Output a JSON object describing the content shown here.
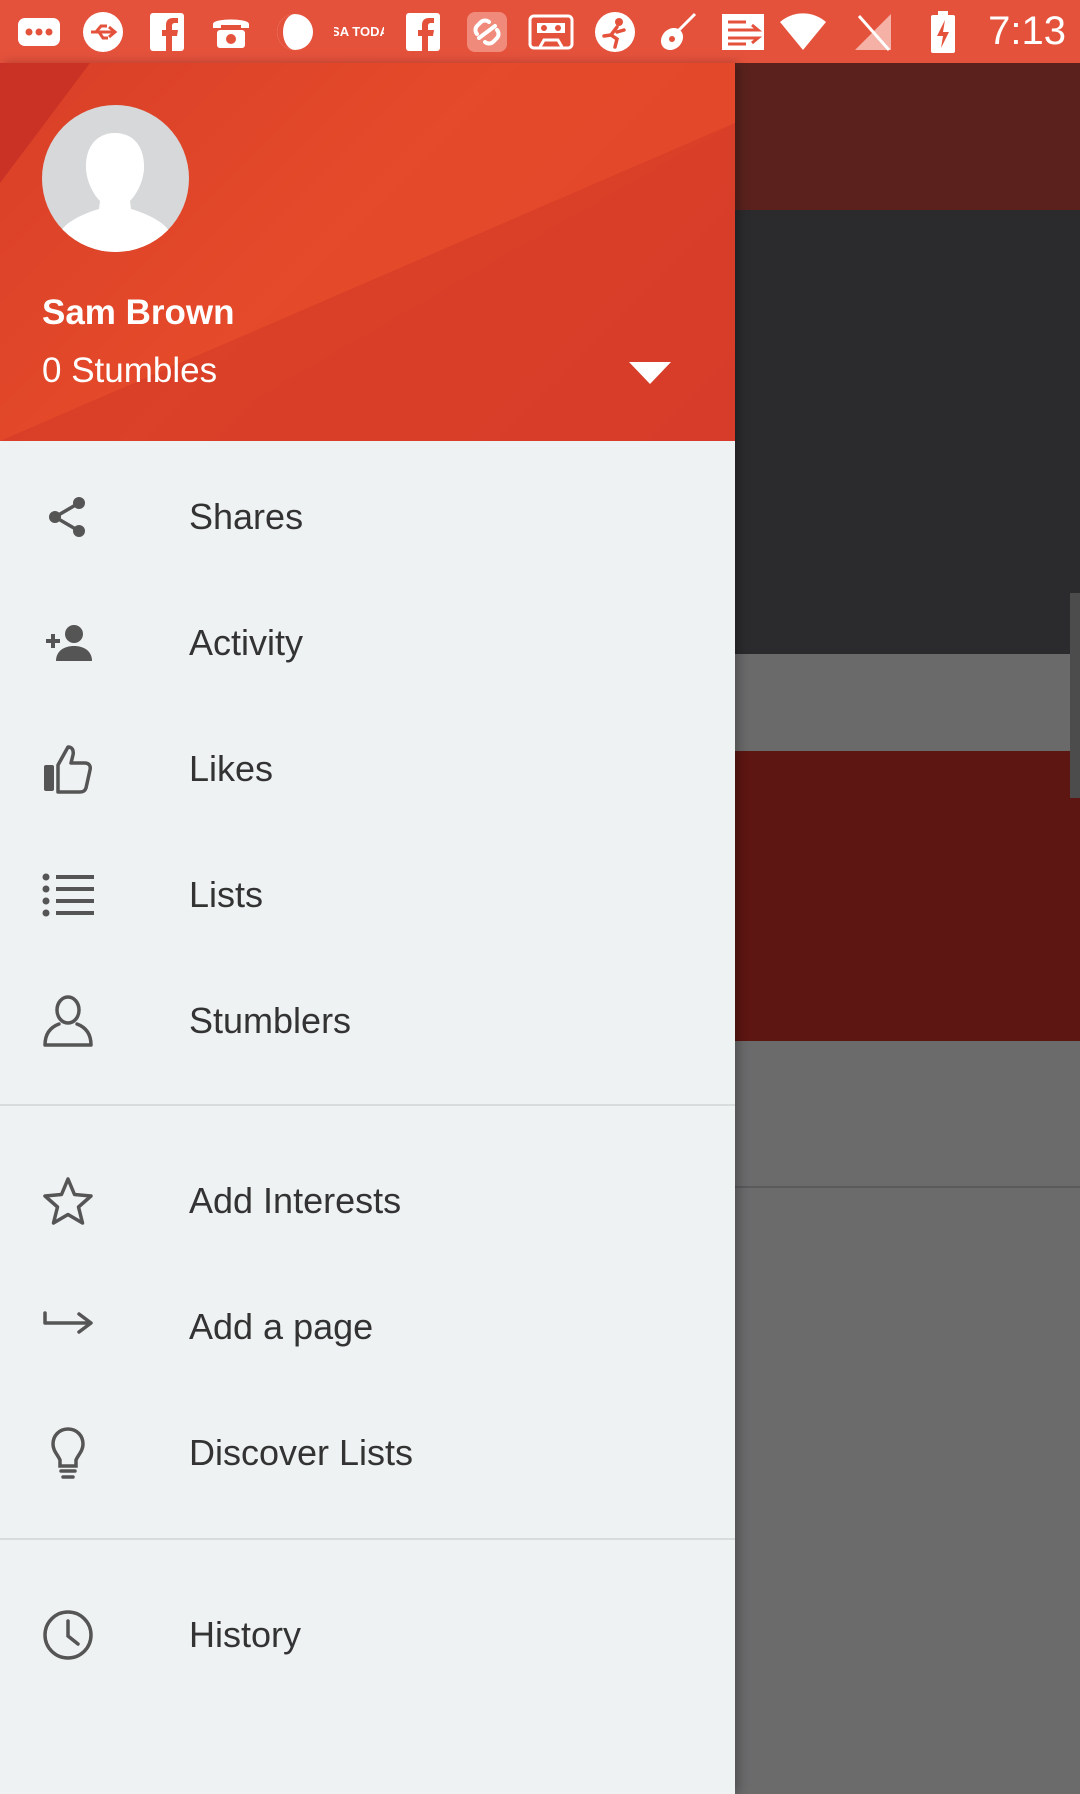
{
  "status_bar": {
    "time": "7:13",
    "notification_icons": [
      "more-icon",
      "usb-icon",
      "facebook-icon",
      "phone-icon",
      "moon-icon",
      "usa-today-icon",
      "facebook-icon",
      "link-icon",
      "cassette-icon",
      "soccer-icon",
      "violin-icon",
      "cast-icon"
    ],
    "usa_today_text": "USA TODAY",
    "system_icons": [
      "wifi-icon",
      "signal-off-icon",
      "battery-charging-icon"
    ]
  },
  "drawer": {
    "header": {
      "name": "Sam Brown",
      "stumbles": "0 Stumbles"
    },
    "sections": [
      {
        "items": [
          {
            "label": "Shares",
            "icon": "share-icon"
          },
          {
            "label": "Activity",
            "icon": "person-add-icon"
          },
          {
            "label": "Likes",
            "icon": "thumbs-up-icon"
          },
          {
            "label": "Lists",
            "icon": "list-icon"
          },
          {
            "label": "Stumblers",
            "icon": "person-outline-icon"
          }
        ]
      },
      {
        "items": [
          {
            "label": "Add Interests",
            "icon": "star-icon"
          },
          {
            "label": "Add a page",
            "icon": "arrow-right-hook-icon"
          },
          {
            "label": "Discover Lists",
            "icon": "lightbulb-icon"
          }
        ]
      },
      {
        "items": [
          {
            "label": "History",
            "icon": "clock-icon"
          }
        ]
      }
    ]
  },
  "colors": {
    "header_accent": "#e5523c",
    "drawer_bg": "#eff2f3",
    "text": "#333333",
    "icon": "#555555"
  }
}
